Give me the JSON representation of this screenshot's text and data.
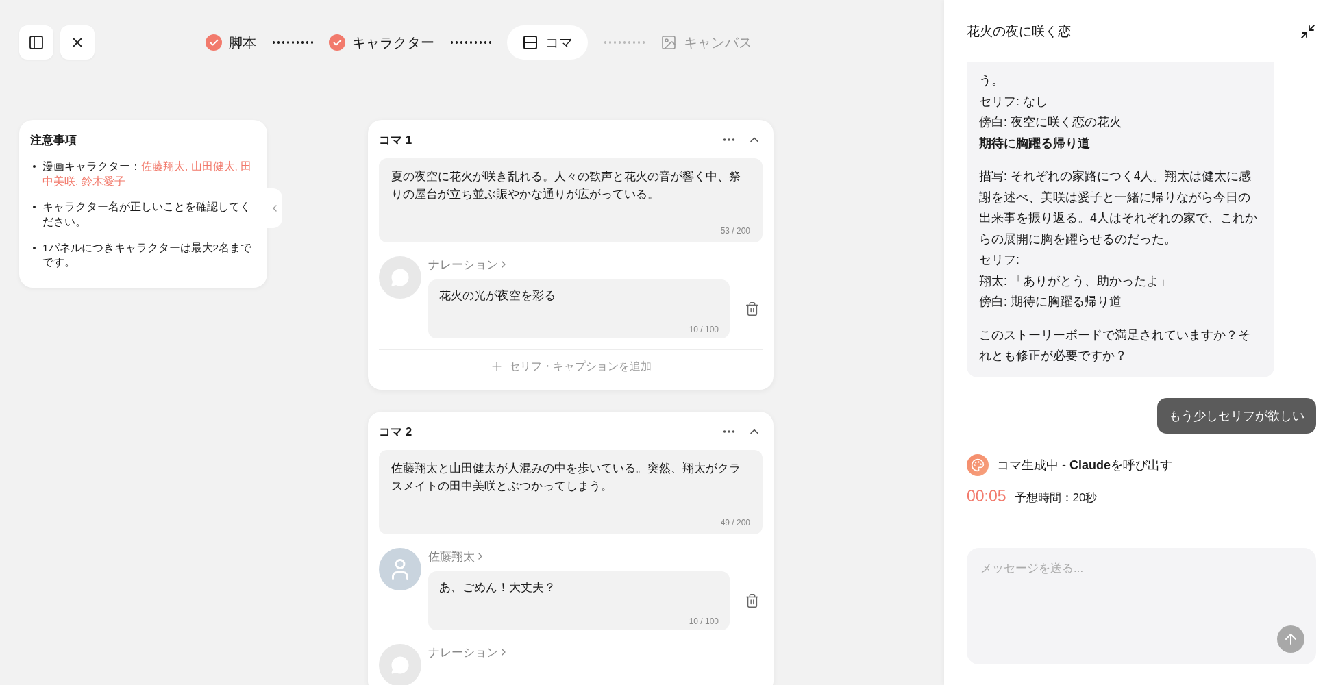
{
  "steps": [
    {
      "label": "脚本",
      "done": true,
      "selected": false
    },
    {
      "label": "キャラクター",
      "done": true,
      "selected": false
    },
    {
      "label": "コマ",
      "done": false,
      "selected": true
    },
    {
      "label": "キャンバス",
      "done": false,
      "selected": false
    }
  ],
  "notes": {
    "title": "注意事項",
    "items": [
      {
        "text": "漫画キャラクター：",
        "highlight": "佐藤翔太, 山田健太, 田中美咲, 鈴木愛子"
      },
      {
        "text": "キャラクター名が正しいことを確認してください。"
      },
      {
        "text": "1パネルにつきキャラクターは最大2名までです。"
      }
    ]
  },
  "panels": [
    {
      "title": "コマ 1",
      "expanded": true,
      "description": "夏の夜空に花火が咲き乱れる。人々の歓声と花火の音が響く中、祭りの屋台が立ち並ぶ賑やかな通りが広がっている。",
      "count": "53 / 200",
      "dialogues": [
        {
          "speaker": "ナレーション",
          "kind": "narration",
          "text": "花火の光が夜空を彩る",
          "count": "10 / 100"
        }
      ],
      "add_label": "セリフ・キャプションを追加"
    },
    {
      "title": "コマ 2",
      "expanded": true,
      "description": "佐藤翔太と山田健太が人混みの中を歩いている。突然、翔太がクラスメイトの田中美咲とぶつかってしまう。",
      "count": "49 / 200",
      "dialogues": [
        {
          "speaker": "佐藤翔太",
          "kind": "character",
          "text": "あ、ごめん！大丈夫？",
          "count": "10 / 100"
        },
        {
          "speaker": "ナレーション",
          "kind": "narration"
        }
      ]
    }
  ],
  "chat": {
    "title": "花火の夜に咲く恋",
    "assistant_message": [
      {
        "kind": "line",
        "text": "う。"
      },
      {
        "kind": "line",
        "text": "セリフ: なし"
      },
      {
        "kind": "line",
        "text": "傍白: 夜空に咲く恋の花火"
      },
      {
        "kind": "heading",
        "text": "期待に胸躍る帰り道"
      },
      {
        "kind": "paragraph",
        "text": "描写: それぞれの家路につく4人。翔太は健太に感謝を述べ、美咲は愛子と一緒に帰りながら今日の出来事を振り返る。4人はそれぞれの家で、これからの展開に胸を躍らせるのだった。"
      },
      {
        "kind": "line",
        "text": "セリフ:"
      },
      {
        "kind": "line",
        "text": "翔太: 「ありがとう、助かったよ」"
      },
      {
        "kind": "line",
        "text": "傍白: 期待に胸躍る帰り道"
      },
      {
        "kind": "paragraph",
        "text": "このストーリーボードで満足されていますか？それとも修正が必要ですか？"
      }
    ],
    "user_message": "もう少しセリフが欲しい",
    "status": {
      "text": "コマ生成中 - **Claude**を呼び出す",
      "timer": "00:05",
      "estimate": "予想時間：20秒"
    },
    "input": {
      "placeholder": "メッセージを送る..."
    }
  }
}
